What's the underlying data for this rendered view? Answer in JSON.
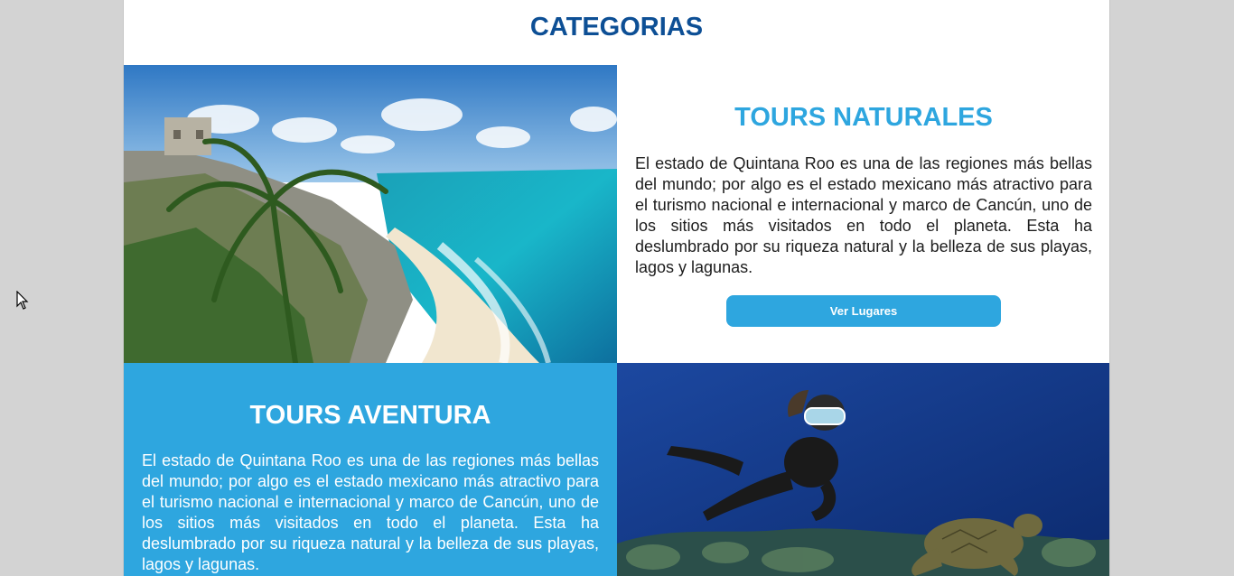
{
  "section": {
    "title": "CATEGORIAS"
  },
  "cards": [
    {
      "title": "TOURS NATURALES",
      "text": "El estado de Quintana Roo es una de las regiones más bellas del mundo; por algo es el estado mexicano más atractivo para el turismo nacional e internacional y marco de Cancún, uno de los sitios más visitados en todo el planeta. Esta ha deslumbrado por su riqueza natural y la belleza de sus playas, lagos y lagunas.",
      "button_label": "Ver Lugares"
    },
    {
      "title": "TOURS AVENTURA",
      "text": "El estado de Quintana Roo es una de las regiones más bellas del mundo; por algo es el estado mexicano más atractivo para el turismo nacional e internacional y marco de Cancún, uno de los sitios más visitados en todo el planeta. Esta ha deslumbrado por su riqueza natural y la belleza de sus playas, lagos y lagunas."
    }
  ],
  "colors": {
    "heading_blue": "#0d4f95",
    "accent_blue": "#2ea6df",
    "page_bg": "#d3d3d3"
  },
  "icons": {
    "cursor": "mouse-pointer-icon"
  }
}
